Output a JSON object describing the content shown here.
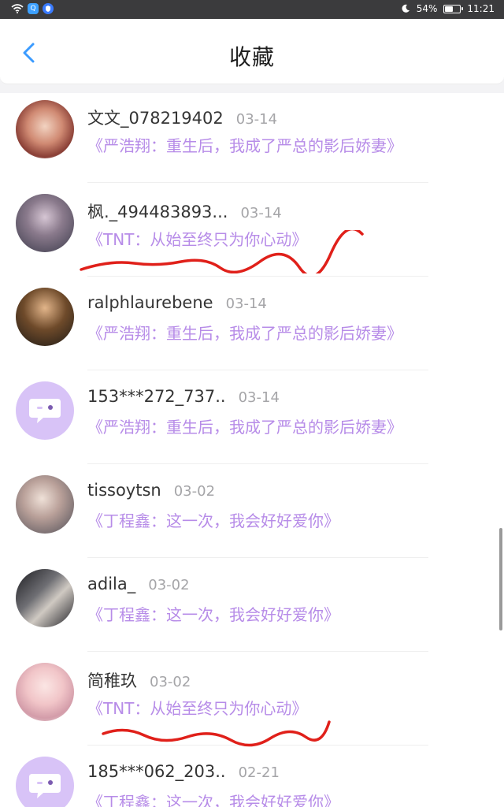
{
  "status_bar": {
    "qq_label": "Q",
    "battery": "54%",
    "battery_level": 0.54,
    "time": "11:21",
    "icons": [
      "wifi-icon",
      "qq-icon",
      "shield-icon",
      "moon-icon",
      "battery-icon"
    ]
  },
  "header": {
    "title": "收藏",
    "back_icon": "chevron-left-icon"
  },
  "colors": {
    "accent": "#3b9bff",
    "book_title": "#b78ce8",
    "annotation": "#e0201a"
  },
  "items": [
    {
      "name": "文文_078219402",
      "date": "03-14",
      "book": "《严浩翔：重生后，我成了严总的影后娇妻》"
    },
    {
      "name": "枫._494483893...",
      "date": "03-14",
      "book": "《TNT：从始至终只为你心动》"
    },
    {
      "name": "ralphlaurebene",
      "date": "03-14",
      "book": "《严浩翔：重生后，我成了严总的影后娇妻》"
    },
    {
      "name": "153***272_737..",
      "date": "03-14",
      "book": "《严浩翔：重生后，我成了严总的影后娇妻》"
    },
    {
      "name": "tissoytsn",
      "date": "03-02",
      "book": "《丁程鑫：这一次，我会好好爱你》"
    },
    {
      "name": "adila_",
      "date": "03-02",
      "book": "《丁程鑫：这一次，我会好好爱你》"
    },
    {
      "name": "简稚玖",
      "date": "03-02",
      "book": "《TNT：从始至终只为你心动》"
    },
    {
      "name": "185***062_203..",
      "date": "02-21",
      "book": "《丁程鑫：这一次，我会好好爱你》"
    }
  ]
}
